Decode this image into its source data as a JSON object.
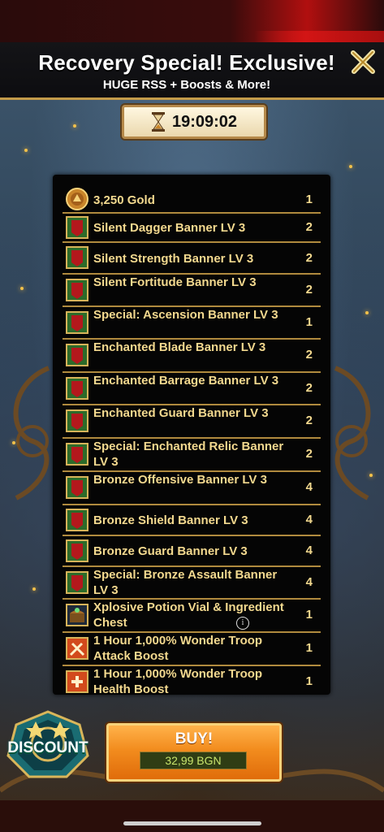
{
  "header": {
    "title": "Recovery Special! Exclusive!",
    "subtitle": "HUGE RSS + Boosts & More!"
  },
  "timer": {
    "value": "19:09:02"
  },
  "items": [
    {
      "name": "3,250 Gold",
      "qty": "1",
      "icon": "gold-coin-icon"
    },
    {
      "name": "Silent Dagger Banner LV 3",
      "qty": "2",
      "icon": "banner-icon"
    },
    {
      "name": "Silent Strength Banner LV 3",
      "qty": "2",
      "icon": "banner-icon"
    },
    {
      "name": "Silent Fortitude Banner LV 3",
      "qty": "2",
      "icon": "banner-icon"
    },
    {
      "name": "Special: Ascension Banner LV 3",
      "qty": "1",
      "icon": "banner-icon"
    },
    {
      "name": "Enchanted Blade Banner LV 3",
      "qty": "2",
      "icon": "banner-icon"
    },
    {
      "name": "Enchanted Barrage Banner LV 3",
      "qty": "2",
      "icon": "banner-icon"
    },
    {
      "name": "Enchanted Guard Banner LV 3",
      "qty": "2",
      "icon": "banner-icon"
    },
    {
      "name": "Special: Enchanted Relic Banner LV 3",
      "qty": "2",
      "icon": "banner-icon"
    },
    {
      "name": "Bronze Offensive Banner LV 3",
      "qty": "4",
      "icon": "banner-icon"
    },
    {
      "name": "Bronze Shield Banner LV 3",
      "qty": "4",
      "icon": "banner-icon"
    },
    {
      "name": "Bronze Guard Banner LV 3",
      "qty": "4",
      "icon": "banner-icon"
    },
    {
      "name": "Special: Bronze Assault Banner LV 3",
      "qty": "4",
      "icon": "banner-icon"
    },
    {
      "name": "Xplosive Potion Vial & Ingredient Chest",
      "qty": "1",
      "icon": "chest-icon"
    },
    {
      "name": "1 Hour 1,000% Wonder Troop Attack Boost",
      "qty": "1",
      "icon": "attack-boost-icon"
    },
    {
      "name": "1 Hour 1,000% Wonder Troop Health Boost",
      "qty": "1",
      "icon": "health-boost-icon"
    }
  ],
  "info_glyph": "i",
  "discount": {
    "label": "DISCOUNT"
  },
  "buy": {
    "label": "BUY!",
    "price": "32,99 BGN"
  },
  "colors": {
    "accent": "#f3d98f",
    "buy_orange": "#f28c1e",
    "border_gold": "#b08a3e"
  }
}
